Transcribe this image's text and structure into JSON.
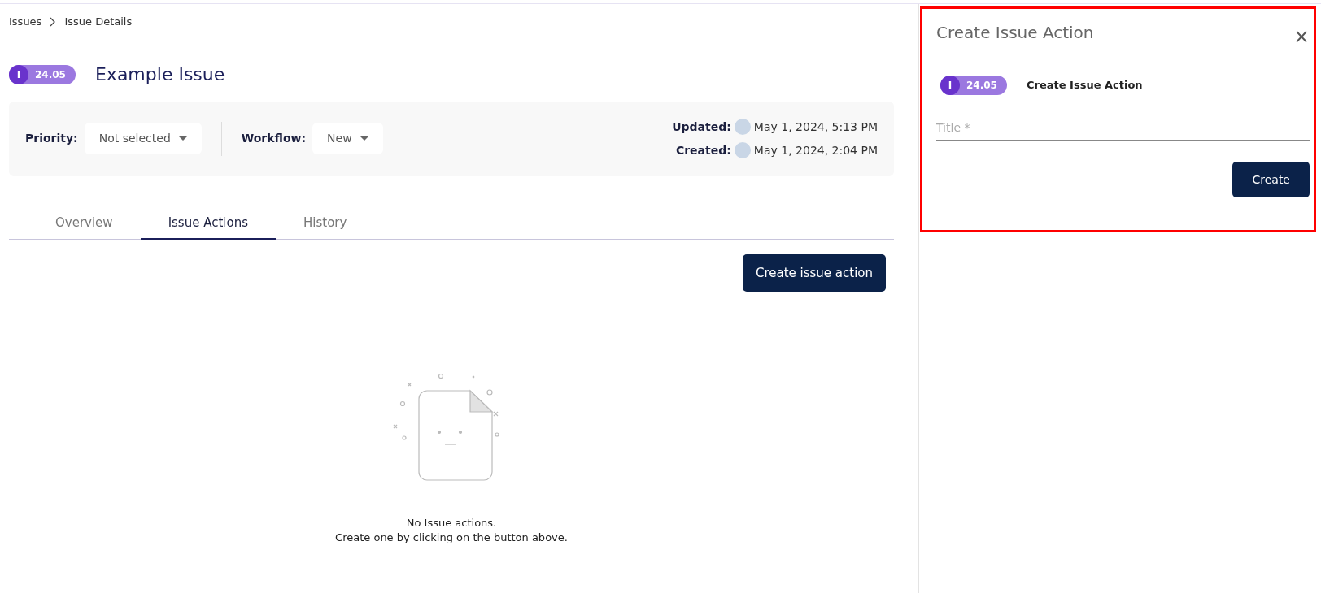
{
  "breadcrumb": [
    "Issues",
    "Issue Details"
  ],
  "issue": {
    "badge_letter": "I",
    "badge_version": "24.05",
    "title": "Example Issue"
  },
  "fields": [
    {
      "label": "Priority:",
      "value": "Not selected"
    },
    {
      "label": "Workflow:",
      "value": "New"
    }
  ],
  "meta": [
    {
      "label": "Updated:",
      "value": "May 1, 2024, 5:13 PM"
    },
    {
      "label": "Created:",
      "value": "May 1, 2024, 2:04 PM"
    }
  ],
  "tabs": [
    {
      "label": "Overview",
      "selected": false
    },
    {
      "label": "Issue Actions",
      "selected": true
    },
    {
      "label": "History",
      "selected": false
    }
  ],
  "create_button": "Create issue action",
  "empty_state": {
    "title": "No Issue actions.",
    "hint": "Create one by clicking on the button above."
  },
  "panel": {
    "title": "Create Issue Action",
    "close": "×",
    "badge_letter": "I",
    "badge_version": "24.05",
    "subtitle": "Create Issue Action",
    "field_placeholder": "Title *",
    "button": "Create"
  }
}
